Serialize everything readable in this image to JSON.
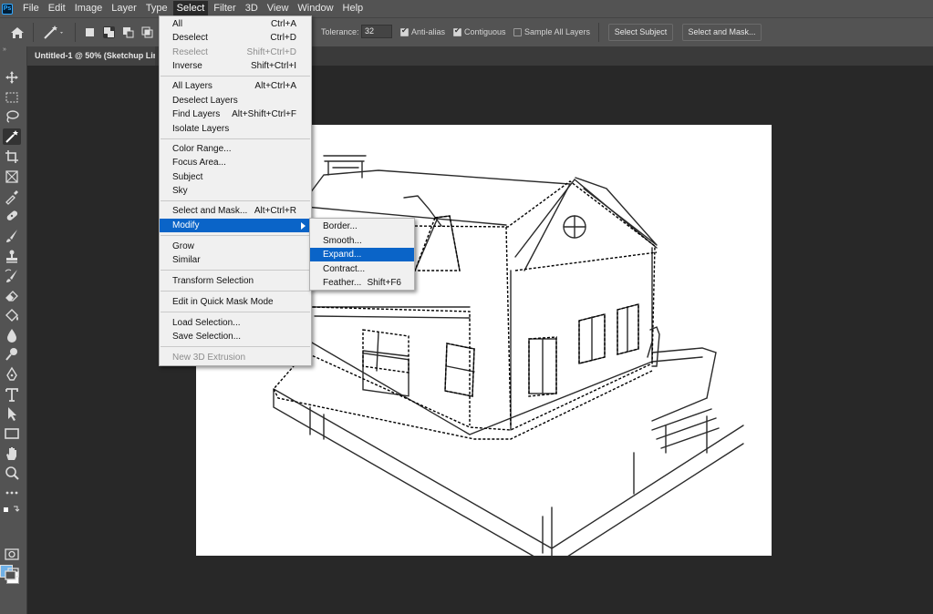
{
  "app": {
    "logo_text": "Ps"
  },
  "menubar": {
    "items": [
      "File",
      "Edit",
      "Image",
      "Layer",
      "Type",
      "Select",
      "Filter",
      "3D",
      "View",
      "Window",
      "Help"
    ],
    "active": "Select"
  },
  "options": {
    "tolerance_label": "Tolerance:",
    "tolerance_value": "32",
    "anti_alias": {
      "label": "Anti-alias",
      "checked": true
    },
    "contiguous": {
      "label": "Contiguous",
      "checked": true
    },
    "sample_all_layers": {
      "label": "Sample All Layers",
      "checked": false
    },
    "select_subject": "Select Subject",
    "select_and_mask": "Select and Mask..."
  },
  "document": {
    "tab_title": "Untitled-1 @ 50% (Sketchup Lin"
  },
  "select_menu": [
    {
      "label": "All",
      "shortcut": "Ctrl+A",
      "enabled": true
    },
    {
      "label": "Deselect",
      "shortcut": "Ctrl+D",
      "enabled": true
    },
    {
      "label": "Reselect",
      "shortcut": "Shift+Ctrl+D",
      "enabled": false
    },
    {
      "label": "Inverse",
      "shortcut": "Shift+Ctrl+I",
      "enabled": true
    },
    {
      "label": "All Layers",
      "shortcut": "Alt+Ctrl+A",
      "enabled": true
    },
    {
      "label": "Deselect Layers",
      "shortcut": "",
      "enabled": true
    },
    {
      "label": "Find Layers",
      "shortcut": "Alt+Shift+Ctrl+F",
      "enabled": true
    },
    {
      "label": "Isolate Layers",
      "shortcut": "",
      "enabled": true
    },
    {
      "label": "Color Range...",
      "shortcut": "",
      "enabled": true
    },
    {
      "label": "Focus Area...",
      "shortcut": "",
      "enabled": true
    },
    {
      "label": "Subject",
      "shortcut": "",
      "enabled": true
    },
    {
      "label": "Sky",
      "shortcut": "",
      "enabled": true
    },
    {
      "label": "Select and Mask...",
      "shortcut": "Alt+Ctrl+R",
      "enabled": true
    },
    {
      "label": "Modify",
      "shortcut": "",
      "enabled": true,
      "submenu": true
    },
    {
      "label": "Grow",
      "shortcut": "",
      "enabled": true
    },
    {
      "label": "Similar",
      "shortcut": "",
      "enabled": true
    },
    {
      "label": "Transform Selection",
      "shortcut": "",
      "enabled": true
    },
    {
      "label": "Edit in Quick Mask Mode",
      "shortcut": "",
      "enabled": true
    },
    {
      "label": "Load Selection...",
      "shortcut": "",
      "enabled": true
    },
    {
      "label": "Save Selection...",
      "shortcut": "",
      "enabled": true
    },
    {
      "label": "New 3D Extrusion",
      "shortcut": "",
      "enabled": false
    }
  ],
  "modify_menu": [
    {
      "label": "Border...",
      "shortcut": ""
    },
    {
      "label": "Smooth...",
      "shortcut": ""
    },
    {
      "label": "Expand...",
      "shortcut": "",
      "highlighted": true
    },
    {
      "label": "Contract...",
      "shortcut": ""
    },
    {
      "label": "Feather...",
      "shortcut": "Shift+F6"
    }
  ],
  "colors": {
    "foreground": "#6fb0e6",
    "background": "#ffffff",
    "menu_highlight": "#0a64c8"
  }
}
